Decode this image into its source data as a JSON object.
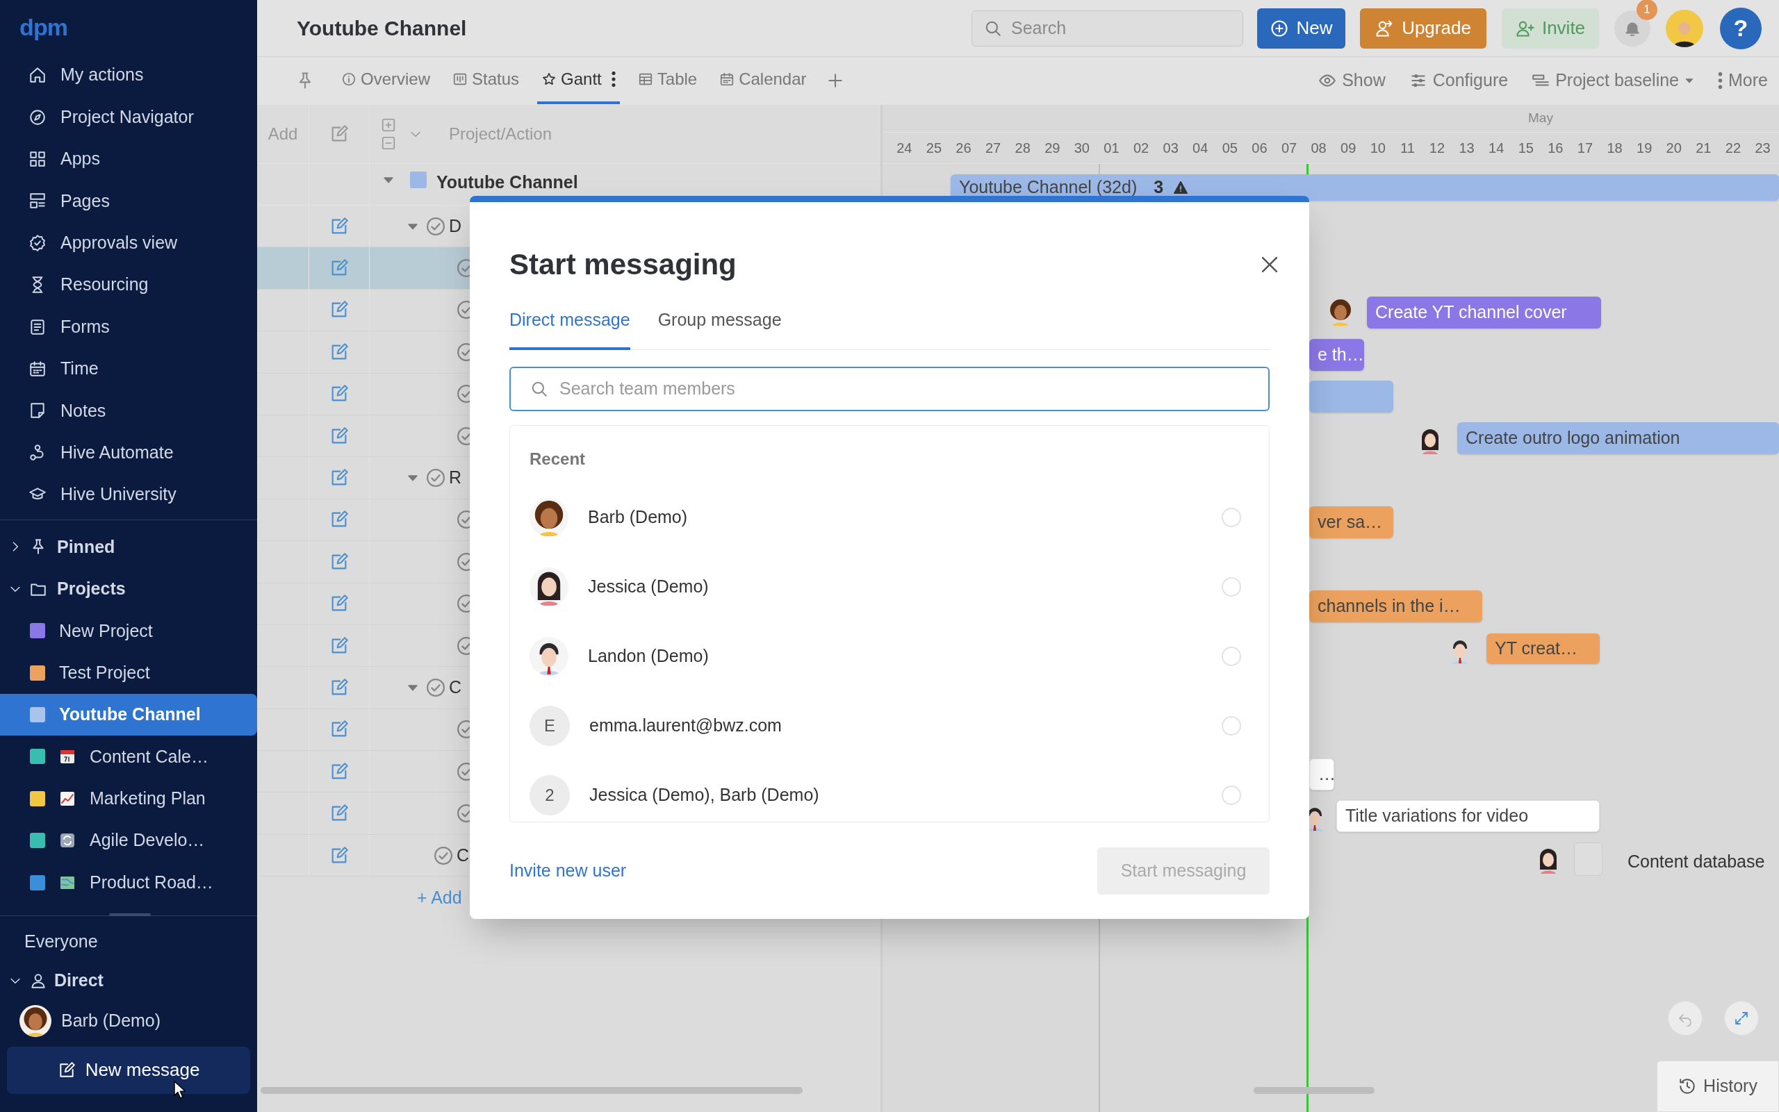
{
  "sidebar": {
    "logo": "dpm",
    "nav": [
      "My actions",
      "Project Navigator",
      "Apps",
      "Pages",
      "Approvals view",
      "Resourcing",
      "Forms",
      "Time",
      "Notes",
      "Hive Automate",
      "Hive University"
    ],
    "pinned": {
      "label": "Pinned",
      "expanded": false
    },
    "projects": {
      "label": "Projects",
      "expanded": true,
      "items": [
        {
          "label": "New Project",
          "color": "#8b78e6",
          "selected": false
        },
        {
          "label": "Test Project",
          "color": "#eca25e",
          "selected": false
        },
        {
          "label": "Youtube Channel",
          "color": "#a9c3ec",
          "selected": true
        },
        {
          "label": "Content Cale…",
          "color": "#38bdb0",
          "selected": false
        },
        {
          "label": "Marketing Plan",
          "color": "#f2c744",
          "selected": false
        },
        {
          "label": "Agile Develo…",
          "color": "#38bdb0",
          "selected": false
        },
        {
          "label": "Product Road…",
          "color": "#3b8fd9",
          "selected": false
        }
      ]
    },
    "everyone": "Everyone",
    "direct": {
      "label": "Direct",
      "expanded": true,
      "people": [
        "Barb (Demo)"
      ]
    },
    "new_message": "New message"
  },
  "header": {
    "title": "Youtube Channel",
    "search_placeholder": "Search",
    "buttons": [
      {
        "kind": "new",
        "label": "New"
      },
      {
        "kind": "upgrade",
        "label": "Upgrade"
      },
      {
        "kind": "invite",
        "label": "Invite"
      }
    ],
    "notification_count": "1",
    "help": "?"
  },
  "view_tabs": [
    {
      "label": "Overview",
      "selected": false
    },
    {
      "label": "Status",
      "selected": false
    },
    {
      "label": "Gantt",
      "selected": true
    },
    {
      "label": "Table",
      "selected": false
    },
    {
      "label": "Calendar",
      "selected": false
    }
  ],
  "view_tools": [
    "Show",
    "Configure",
    "Project baseline",
    "More"
  ],
  "grid": {
    "columns": [
      "Add",
      "Project/Action"
    ],
    "project": "Youtube Channel",
    "rows": [
      {
        "kind": "group",
        "label": "D",
        "selected": false
      },
      {
        "kind": "task",
        "selected": true
      },
      {
        "kind": "task",
        "selected": false
      },
      {
        "kind": "task",
        "selected": false
      },
      {
        "kind": "task",
        "selected": false
      },
      {
        "kind": "task",
        "selected": false
      },
      {
        "kind": "group",
        "label": "R",
        "selected": false
      },
      {
        "kind": "task",
        "selected": false
      },
      {
        "kind": "task",
        "selected": false
      },
      {
        "kind": "task",
        "selected": false
      },
      {
        "kind": "task",
        "selected": false
      },
      {
        "kind": "group",
        "label": "C",
        "selected": false
      },
      {
        "kind": "task",
        "selected": false
      },
      {
        "kind": "task",
        "selected": false
      },
      {
        "kind": "task",
        "selected": false
      },
      {
        "kind": "action",
        "label": "C",
        "selected": false
      }
    ],
    "add_label": "+ Add"
  },
  "gantt": {
    "month": "May",
    "dates": [
      "24",
      "25",
      "26",
      "27",
      "28",
      "29",
      "30",
      "01",
      "02",
      "03",
      "04",
      "05",
      "06",
      "07",
      "08",
      "09",
      "10",
      "11",
      "12",
      "13",
      "14",
      "15",
      "16",
      "17",
      "18",
      "19",
      "20",
      "21",
      "22",
      "23"
    ],
    "items": [
      {
        "kind": "bar",
        "label": "Youtube Channel (32d)",
        "color": "#9bb8e6",
        "count": "3",
        "warning": true
      },
      {
        "kind": "bar",
        "label": "Create YT channel cover",
        "color": "#8b78e6"
      },
      {
        "kind": "bar",
        "label": "e th…",
        "color": "#8b78e6"
      },
      {
        "kind": "bar",
        "color": "#9bb8e6"
      },
      {
        "kind": "bar",
        "label": "Create outro logo animation",
        "color": "#9bb8e6"
      },
      {
        "kind": "bar",
        "label": "ver sa…",
        "color": "#eca25e"
      },
      {
        "kind": "bar",
        "label": "channels in the i…",
        "color": "#eca25e"
      },
      {
        "kind": "bar",
        "label": "YT creat…",
        "color": "#eca25e"
      },
      {
        "kind": "bar",
        "label": "…",
        "color": "#ffffff"
      },
      {
        "kind": "bar",
        "label": "Title variations for video",
        "color": "#ffffff"
      },
      {
        "kind": "milestone",
        "label": "Content database"
      }
    ]
  },
  "modal": {
    "title": "Start messaging",
    "tabs": [
      {
        "label": "Direct message",
        "selected": true
      },
      {
        "label": "Group message",
        "selected": false
      }
    ],
    "search_placeholder": "Search team members",
    "section": "Recent",
    "contacts": [
      {
        "kind": "avatar",
        "name": "Barb (Demo)",
        "selected": false
      },
      {
        "kind": "avatar",
        "name": "Jessica (Demo)",
        "selected": false
      },
      {
        "kind": "avatar",
        "name": "Landon (Demo)",
        "selected": false
      },
      {
        "kind": "initial",
        "initial": "E",
        "name": "emma.laurent@bwz.com",
        "selected": false
      },
      {
        "kind": "initial",
        "initial": "2",
        "name": "Jessica (Demo), Barb (Demo)",
        "selected": false
      }
    ],
    "invite_link": "Invite new user",
    "submit": {
      "label": "Start messaging",
      "disabled": true
    }
  },
  "history": "History"
}
